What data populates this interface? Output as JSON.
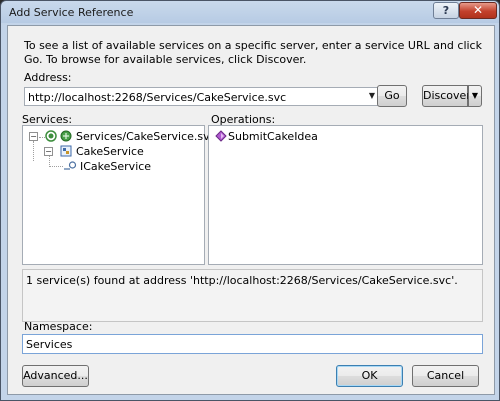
{
  "window": {
    "title": "Add Service Reference",
    "help_label": "?",
    "close_label": "✕"
  },
  "intro_text": "To see a list of available services on a specific server, enter a service URL and click Go. To browse for available services, click Discover.",
  "address": {
    "label": "Address:",
    "value": "http://localhost:2268/Services/CakeService.svc",
    "go_label": "Go",
    "discover_label": "Discover"
  },
  "services": {
    "label": "Services:",
    "tree": [
      {
        "label": "Services/CakeService.svc",
        "icon": "service-reference-icon",
        "expander": "−"
      },
      {
        "label": "CakeService",
        "icon": "service-class-icon",
        "expander": "−"
      },
      {
        "label": "ICakeService",
        "icon": "interface-icon"
      }
    ]
  },
  "operations": {
    "label": "Operations:",
    "items": [
      {
        "label": "SubmitCakeIdea",
        "icon": "method-icon"
      }
    ]
  },
  "status_text": "1 service(s) found at address 'http://localhost:2268/Services/CakeService.svc'.",
  "namespace": {
    "label": "Namespace:",
    "value": "Services"
  },
  "buttons": {
    "advanced": "Advanced...",
    "ok": "OK",
    "cancel": "Cancel"
  },
  "colors": {
    "close_button": "#c3412c",
    "focus_border": "#7aa4d8",
    "method_icon": "#9b3fbf",
    "service_icon": "#2e8b2e"
  }
}
